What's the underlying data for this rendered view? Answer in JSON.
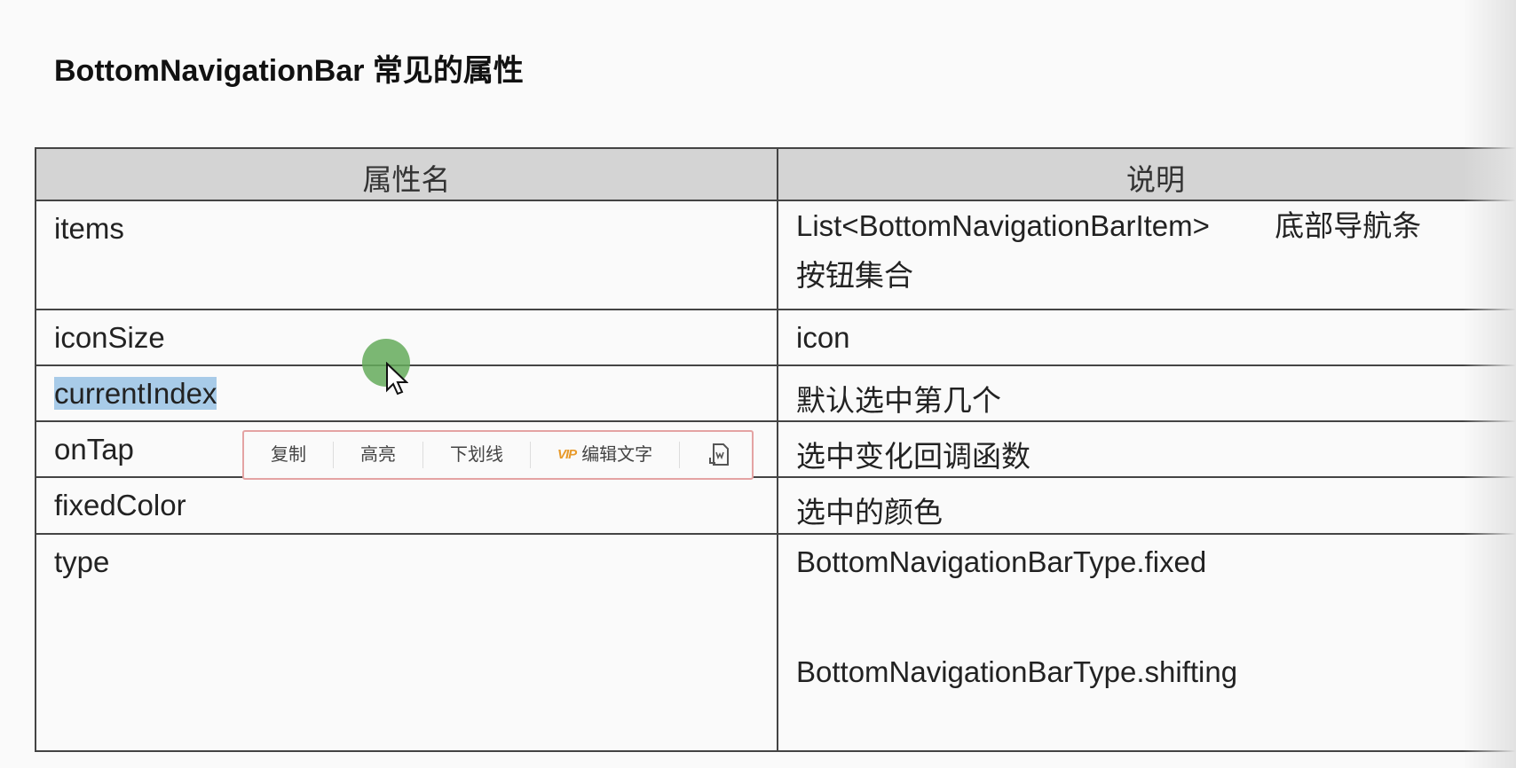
{
  "title": "BottomNavigationBar  常见的属性",
  "table": {
    "headers": [
      "属性名",
      "说明"
    ],
    "rows": [
      {
        "name": "items",
        "desc": "List<BottomNavigationBarItem>        底部导航条按钮集合"
      },
      {
        "name": "iconSize",
        "desc": "icon"
      },
      {
        "name": "currentIndex",
        "desc": "默认选中第几个"
      },
      {
        "name": "onTap",
        "desc": "选中变化回调函数"
      },
      {
        "name": "fixedColor",
        "desc": "选中的颜色"
      },
      {
        "name": "type",
        "desc": "BottomNavigationBarType.fixed",
        "desc2": "BottomNavigationBarType.shifting"
      }
    ]
  },
  "selection_toolbar": {
    "copy": "复制",
    "highlight": "高亮",
    "underline": "下划线",
    "vip_badge": "VIP",
    "edit_text": "编辑文字",
    "to_word_icon": "file-word-icon"
  }
}
